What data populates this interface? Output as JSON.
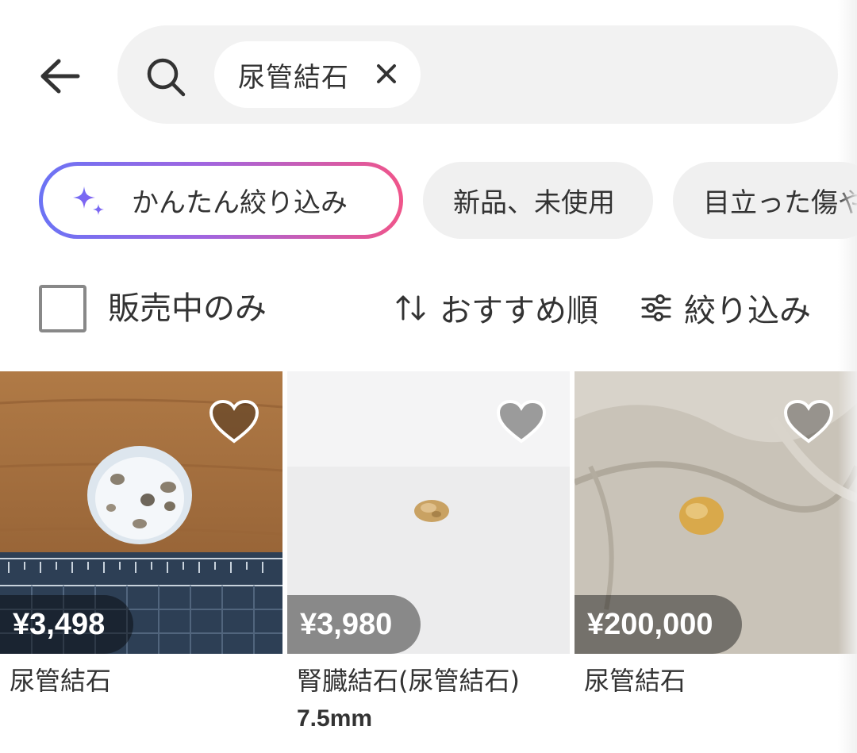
{
  "header": {
    "back_icon": "arrow-left-icon",
    "search_icon": "search-icon",
    "search_chip": "尿管結石",
    "clear_icon": "close-icon"
  },
  "filter_chips": {
    "ai_chip": "かんたん絞り込み",
    "ai_icon": "sparkle-icon",
    "chips": [
      "新品、未使用",
      "目立った傷や"
    ]
  },
  "controls": {
    "on_sale_only": "販売中のみ",
    "on_sale_checked": false,
    "sort_label": "おすすめ順",
    "sort_icon": "sort-arrows-icon",
    "filter_label": "絞り込み",
    "filter_icon": "sliders-icon"
  },
  "products": [
    {
      "price": "¥3,498",
      "name": "尿管結石",
      "subtitle": "",
      "liked": false
    },
    {
      "price": "¥3,980",
      "name": "腎臓結石(尿管結石)",
      "subtitle": "7.5mm",
      "liked": false
    },
    {
      "price": "¥200,000",
      "name": "尿管結石",
      "subtitle": "",
      "liked": false
    }
  ],
  "colors": {
    "accent_gradient_start": "#6b73f5",
    "accent_gradient_end": "#f0558a",
    "chip_bg": "#f0f0f0",
    "text": "#333333"
  }
}
